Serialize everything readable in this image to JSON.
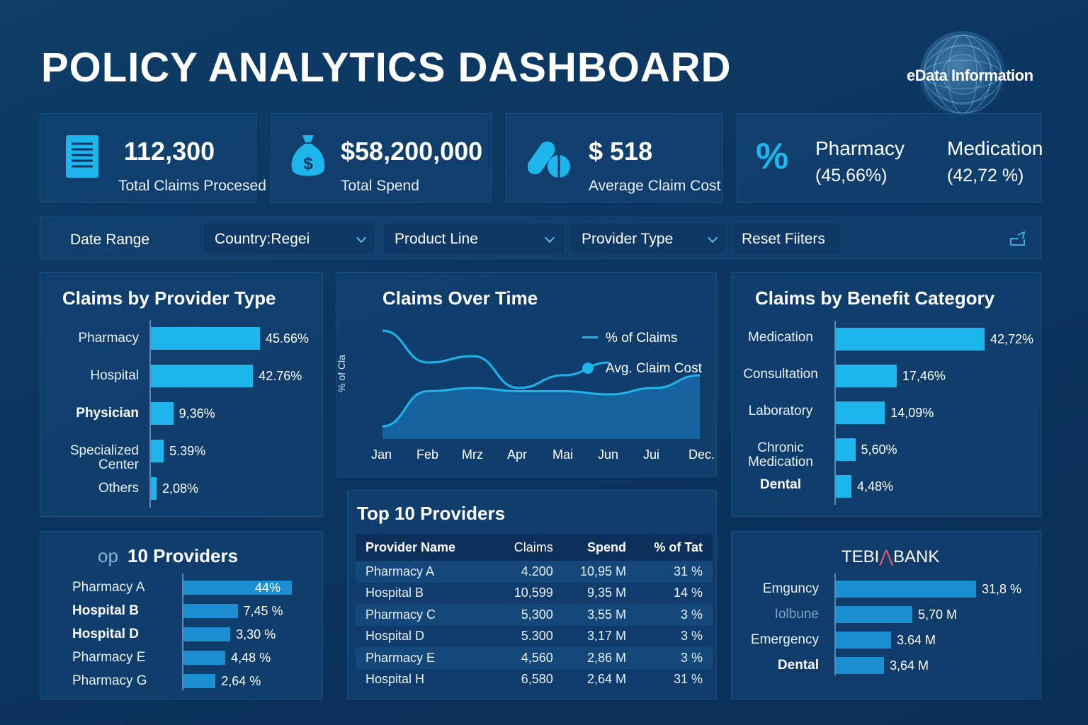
{
  "header": {
    "title": "POLICY ANALYTICS DASHBOARD",
    "logo_text": "eData Information"
  },
  "kpis": {
    "claims": {
      "value": "112,300",
      "label": "Total Claims Procesed"
    },
    "spend": {
      "value": "$58,200,000",
      "label": "Total Spend"
    },
    "avg": {
      "value": "$ 518",
      "label": "Average Claim Cost"
    },
    "share": {
      "symbol": "%",
      "a_name": "Pharmacy",
      "a_value": "(45,66%)",
      "b_name": "Medication",
      "b_value": "(42,72 %)"
    }
  },
  "filters": {
    "date_range": "Date Range",
    "country": "Country:Regei",
    "product_line": "Product Line",
    "provider_type": "Provider Type",
    "reset": "Reset Fiiters"
  },
  "colors": {
    "accent": "#1eb4ec",
    "background": "#0b3560"
  },
  "provider_type_chart": {
    "title": "Claims by Provider Type",
    "items": [
      {
        "label": "Pharmacy",
        "value": 45.66,
        "display": "45.66%"
      },
      {
        "label": "Hospital",
        "value": 42.76,
        "display": "42.76%"
      },
      {
        "label": "Physician",
        "value": 9.36,
        "display": "9,36%"
      },
      {
        "label": "Specialized Center",
        "value": 5.39,
        "display": "5.39%"
      },
      {
        "label": "Others",
        "value": 2.08,
        "display": "2,08%"
      }
    ]
  },
  "over_time": {
    "title": "Claims Over Time",
    "legend_a": "% of Claims",
    "legend_b": "Avg. Claim Cost",
    "ylabel": "% of Cla",
    "months": [
      "Jan",
      "Feb",
      "Mrz",
      "Apr",
      "Mai",
      "Jun",
      "Jui",
      "Dec."
    ]
  },
  "benefit_chart": {
    "title": "Claims by Benefit Category",
    "items": [
      {
        "label": "Medication",
        "value": 42.72,
        "display": "42,72%"
      },
      {
        "label": "Consultation",
        "value": 17.46,
        "display": "17,46%"
      },
      {
        "label": "Laboratory",
        "value": 14.09,
        "display": "14,09%"
      },
      {
        "label": "Chronic Medication",
        "value": 5.6,
        "display": "5,60%"
      },
      {
        "label": "Dental",
        "value": 4.48,
        "display": "4,48%"
      }
    ]
  },
  "top_providers_bars": {
    "title_prefix": "op",
    "title": "10 Providers",
    "items": [
      {
        "label": "Pharmacy A",
        "value": 44,
        "display": "44%"
      },
      {
        "label": "Hospital B",
        "value": 22,
        "display": "7,45 %"
      },
      {
        "label": "Hospital D",
        "value": 19,
        "display": "3,30 %"
      },
      {
        "label": "Pharmacy E",
        "value": 17,
        "display": "4,48 %"
      },
      {
        "label": "Pharmacy G",
        "value": 13,
        "display": "2,64 %"
      }
    ]
  },
  "top_providers_table": {
    "title": "Top 10 Providers",
    "columns": [
      "Provider Name",
      "Claims",
      "Spend",
      "% of Tat"
    ],
    "rows": [
      [
        "Pharmacy A",
        "4.200",
        "10,95 M",
        "31 %"
      ],
      [
        "Hospital B",
        "10,599",
        "9,35 M",
        "14 %"
      ],
      [
        "Pharmacy C",
        "5,300",
        "3,55 M",
        "3 %"
      ],
      [
        "Hospital D",
        "5.300",
        "3,17 M",
        "3 %"
      ],
      [
        "Pharmacy E",
        "4,560",
        "2,86 M",
        "3 %"
      ],
      [
        "Hospital H",
        "6,580",
        "2,64 M",
        "31 %"
      ]
    ]
  },
  "bank_chart": {
    "title_a": "TEBI",
    "title_b": "BANK",
    "items": [
      {
        "label": "Emguncy",
        "value": 31.8,
        "display": "31,8 %"
      },
      {
        "label": "Iolbune",
        "value": 5.7,
        "display": "5,70 M"
      },
      {
        "label": "Emergency",
        "value": 3.64,
        "display": "3.64 M"
      },
      {
        "label": "Dental",
        "value": 3.64,
        "display": "3,64 M"
      }
    ]
  },
  "chart_data": [
    {
      "type": "bar",
      "title": "Claims by Provider Type",
      "categories": [
        "Pharmacy",
        "Hospital",
        "Physician",
        "Specialized Center",
        "Others"
      ],
      "values": [
        45.66,
        42.76,
        9.36,
        5.39,
        2.08
      ]
    },
    {
      "type": "line",
      "title": "Claims Over Time",
      "ylabel": "% of Cla",
      "categories": [
        "Jan",
        "Feb",
        "Mrz",
        "Apr",
        "Mai",
        "Jun",
        "Jui",
        "Dec."
      ],
      "series": [
        {
          "name": "% of Claims",
          "values": [
            5.4,
            6.5,
            6.6,
            6.5,
            6.5,
            6.4,
            6.6,
            7.0
          ]
        },
        {
          "name": "Avg. Claim Cost",
          "values": [
            8.4,
            7.4,
            7.6,
            6.6,
            7.0,
            7.4
          ]
        }
      ],
      "ylim": [
        5,
        9
      ]
    },
    {
      "type": "bar",
      "title": "Claims by Benefit Category",
      "categories": [
        "Medication",
        "Consultation",
        "Laboratory",
        "Chronic Medication",
        "Dental"
      ],
      "values": [
        42.72,
        17.46,
        14.09,
        5.6,
        4.48
      ]
    }
  ]
}
